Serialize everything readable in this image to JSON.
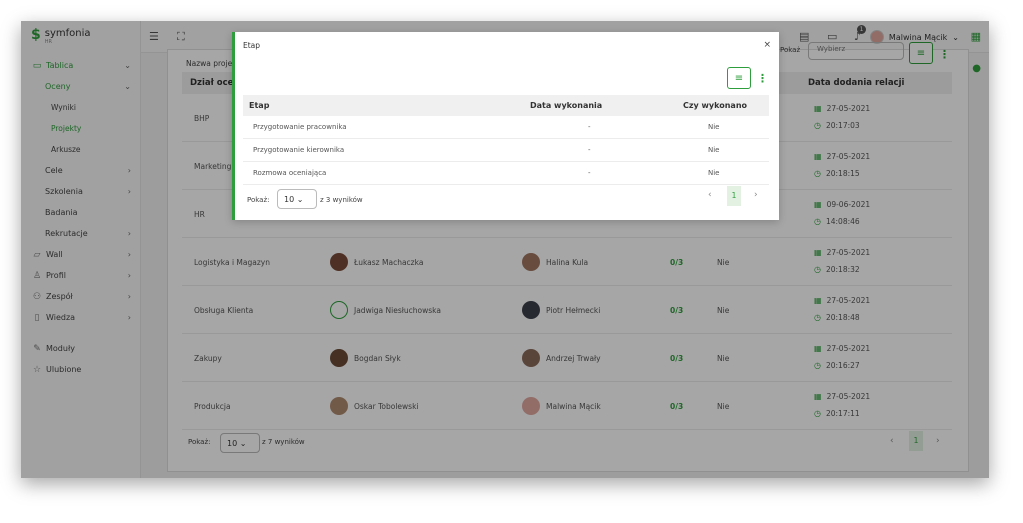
{
  "app": {
    "logo": "symfonia",
    "logo_sub": "HR"
  },
  "sidebar": {
    "items": [
      {
        "label": "Tablica",
        "icon": "monitor-icon",
        "chevron": "⌄",
        "active": true
      },
      {
        "label": "Oceny",
        "chevron": "⌄",
        "active": true
      },
      {
        "label": "Wyniki"
      },
      {
        "label": "Projekty",
        "active": true
      },
      {
        "label": "Arkusze"
      },
      {
        "label": "Cele",
        "chevron": "›"
      },
      {
        "label": "Szkolenia",
        "chevron": "›"
      },
      {
        "label": "Badania"
      },
      {
        "label": "Rekrutacje",
        "chevron": "›"
      },
      {
        "label": "Wall",
        "icon": "chat-icon",
        "chevron": "›"
      },
      {
        "label": "Profil",
        "icon": "person-icon",
        "chevron": "›"
      },
      {
        "label": "Zespół",
        "icon": "team-icon",
        "chevron": "›"
      },
      {
        "label": "Wiedza",
        "icon": "book-icon",
        "chevron": "›"
      },
      {
        "label": "Moduły",
        "icon": "pencil-icon"
      },
      {
        "label": "Ulubione",
        "icon": "star-icon"
      }
    ]
  },
  "topbar": {
    "user_name": "Malwina Mącik",
    "notification_count": "1",
    "pokaz_label": "Pokaż",
    "pokaz_select": "Wybierz"
  },
  "main": {
    "filter_label": "Nazwa projek",
    "columns": {
      "dzial": "Dział oceni",
      "data_dodania": "Data dodania relacji"
    },
    "rows": [
      {
        "dzial": "BHP",
        "osoba1": "",
        "osoba2": "",
        "wynik": "",
        "status": "",
        "date": "27-05-2021",
        "time": "20:17:03"
      },
      {
        "dzial": "Marketing",
        "osoba1": "",
        "osoba2": "",
        "wynik": "",
        "status": "",
        "date": "27-05-2021",
        "time": "20:18:15"
      },
      {
        "dzial": "HR",
        "osoba1": "",
        "osoba2": "",
        "wynik": "",
        "status": "",
        "date": "09-06-2021",
        "time": "14:08:46"
      },
      {
        "dzial": "Logistyka i Magazyn",
        "osoba1": "Łukasz Machaczka",
        "osoba2": "Halina Kula",
        "wynik": "0/3",
        "status": "Nie",
        "date": "27-05-2021",
        "time": "20:18:32"
      },
      {
        "dzial": "Obsługa Klienta",
        "osoba1": "Jadwiga Niesłuchowska",
        "osoba2": "Piotr Hełmecki",
        "wynik": "0/3",
        "status": "Nie",
        "date": "27-05-2021",
        "time": "20:18:48"
      },
      {
        "dzial": "Zakupy",
        "osoba1": "Bogdan Słyk",
        "osoba2": "Andrzej Trwały",
        "wynik": "0/3",
        "status": "Nie",
        "date": "27-05-2021",
        "time": "20:16:27"
      },
      {
        "dzial": "Produkcja",
        "osoba1": "Oskar Tobolewski",
        "osoba2": "Malwina Mącik",
        "wynik": "0/3",
        "status": "Nie",
        "date": "27-05-2021",
        "time": "20:17:11"
      }
    ],
    "pager": {
      "label": "Pokaż:",
      "page_size": "10",
      "summary": "z 7 wyników",
      "page": "1"
    }
  },
  "modal": {
    "title": "Etap",
    "close": "×",
    "columns": {
      "etap": "Etap",
      "data": "Data wykonania",
      "czy": "Czy wykonano"
    },
    "rows": [
      {
        "etap": "Przygotowanie pracownika",
        "data": "-",
        "czy": "Nie"
      },
      {
        "etap": "Przygotowanie kierownika",
        "data": "-",
        "czy": "Nie"
      },
      {
        "etap": "Rozmowa oceniająca",
        "data": "-",
        "czy": "Nie"
      }
    ],
    "pager": {
      "label": "Pokaż:",
      "page_size": "10",
      "summary": "z 3 wyników",
      "page": "1"
    }
  },
  "colors": {
    "accent": "#2e9e3c"
  }
}
